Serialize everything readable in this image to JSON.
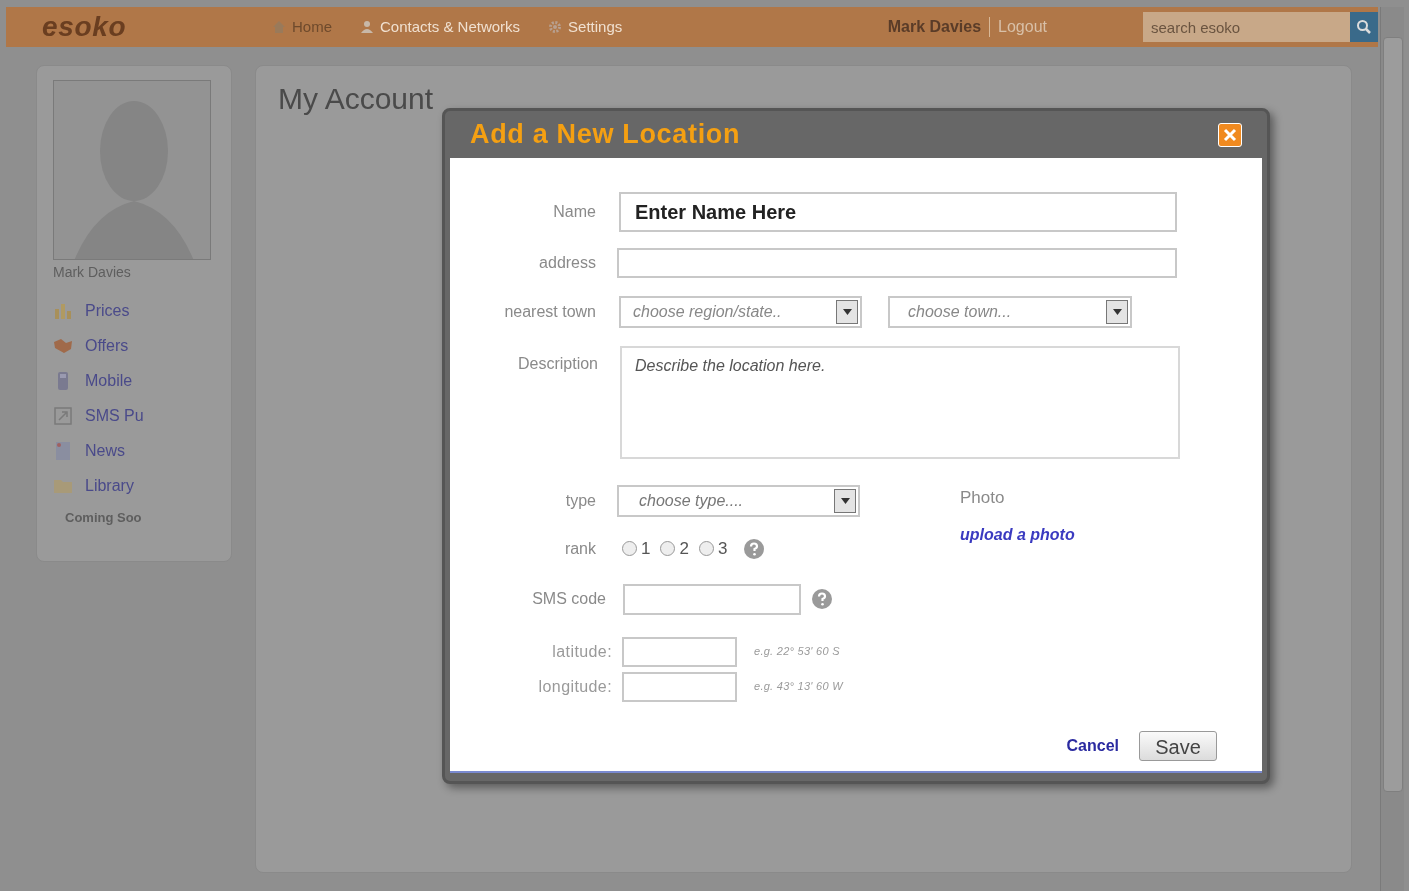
{
  "header": {
    "logo": "esoko",
    "nav": [
      {
        "label": "Home"
      },
      {
        "label": "Contacts & Networks"
      },
      {
        "label": "Settings"
      }
    ],
    "user": "Mark Davies",
    "logout": "Logout",
    "search": {
      "placeholder": "search esoko"
    }
  },
  "sidebar": {
    "profile_name": "Mark Davies",
    "items": [
      {
        "label": "Prices"
      },
      {
        "label": "Offers"
      },
      {
        "label": "Mobile"
      },
      {
        "label": "SMS Pu"
      },
      {
        "label": "News"
      },
      {
        "label": "Library"
      }
    ],
    "note": "Coming Soo"
  },
  "page_title": "My Account",
  "dialog": {
    "title": "Add a New Location",
    "name": {
      "label": "Name",
      "value": "Enter Name Here"
    },
    "address": {
      "label": "address"
    },
    "nearest_town": {
      "label": "nearest town",
      "selects": [
        {
          "placeholder": "choose region/state.."
        },
        {
          "placeholder": "choose town..."
        }
      ]
    },
    "description": {
      "label": "Description",
      "placeholder": "Describe the location here."
    },
    "type": {
      "label": "type",
      "placeholder": "choose type...."
    },
    "rank": {
      "label": "rank",
      "options": [
        {
          "label": "1",
          "checked": false
        },
        {
          "label": "2",
          "checked": false
        },
        {
          "label": "3",
          "checked": false
        }
      ]
    },
    "sms_code": {
      "label": "SMS code"
    },
    "latitude": {
      "label": "latitude:",
      "hint": "e.g. 22° 53' 60 S"
    },
    "longitude": {
      "label": "longitude:",
      "hint": "e.g. 43° 13' 60 W"
    },
    "photo": {
      "label": "Photo",
      "link": "upload a photo"
    },
    "cancel": "Cancel",
    "save": "Save"
  }
}
